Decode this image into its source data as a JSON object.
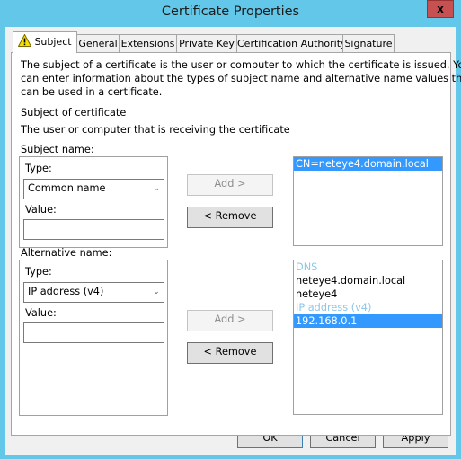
{
  "window": {
    "title": "Certificate Properties",
    "close_glyph": "x"
  },
  "tabs": [
    {
      "label": "Subject",
      "icon": "warning-icon",
      "active": true
    },
    {
      "label": "General",
      "active": false
    },
    {
      "label": "Extensions",
      "active": false
    },
    {
      "label": "Private Key",
      "active": false
    },
    {
      "label": "Certification Authority",
      "active": false
    },
    {
      "label": "Signature",
      "active": false
    }
  ],
  "subject_tab": {
    "description": [
      "The subject of a certificate is the user or computer to which the certificate is issued. You",
      "can enter information about the types of subject name and alternative name values that",
      "can be used in a certificate."
    ],
    "section_title": "Subject of certificate",
    "section_subtitle": "The user or computer that is receiving the certificate",
    "subject_name": {
      "label": "Subject name:",
      "type_label": "Type:",
      "type_value": "Common name",
      "value_label": "Value:",
      "value": "",
      "add_label": "Add >",
      "remove_label": "< Remove",
      "list": [
        {
          "text": "CN=neteye4.domain.local",
          "kind": "item",
          "selected": true
        }
      ]
    },
    "alternative_name": {
      "label": "Alternative name:",
      "type_label": "Type:",
      "type_value": "IP address (v4)",
      "value_label": "Value:",
      "value": "",
      "add_label": "Add >",
      "remove_label": "< Remove",
      "list": [
        {
          "text": "DNS",
          "kind": "header",
          "selected": false
        },
        {
          "text": "neteye4.domain.local",
          "kind": "item",
          "selected": false
        },
        {
          "text": "neteye4",
          "kind": "item",
          "selected": false
        },
        {
          "text": "IP address (v4)",
          "kind": "header",
          "selected": false
        },
        {
          "text": "192.168.0.1",
          "kind": "item",
          "selected": true
        }
      ]
    }
  },
  "footer": {
    "ok_label": "OK",
    "cancel_label": "Cancel",
    "apply_label": "Apply"
  },
  "colors": {
    "frame": "#62c7e8",
    "close_button": "#c75050",
    "selection": "#3399ff",
    "list_header": "#8fc6e6"
  }
}
